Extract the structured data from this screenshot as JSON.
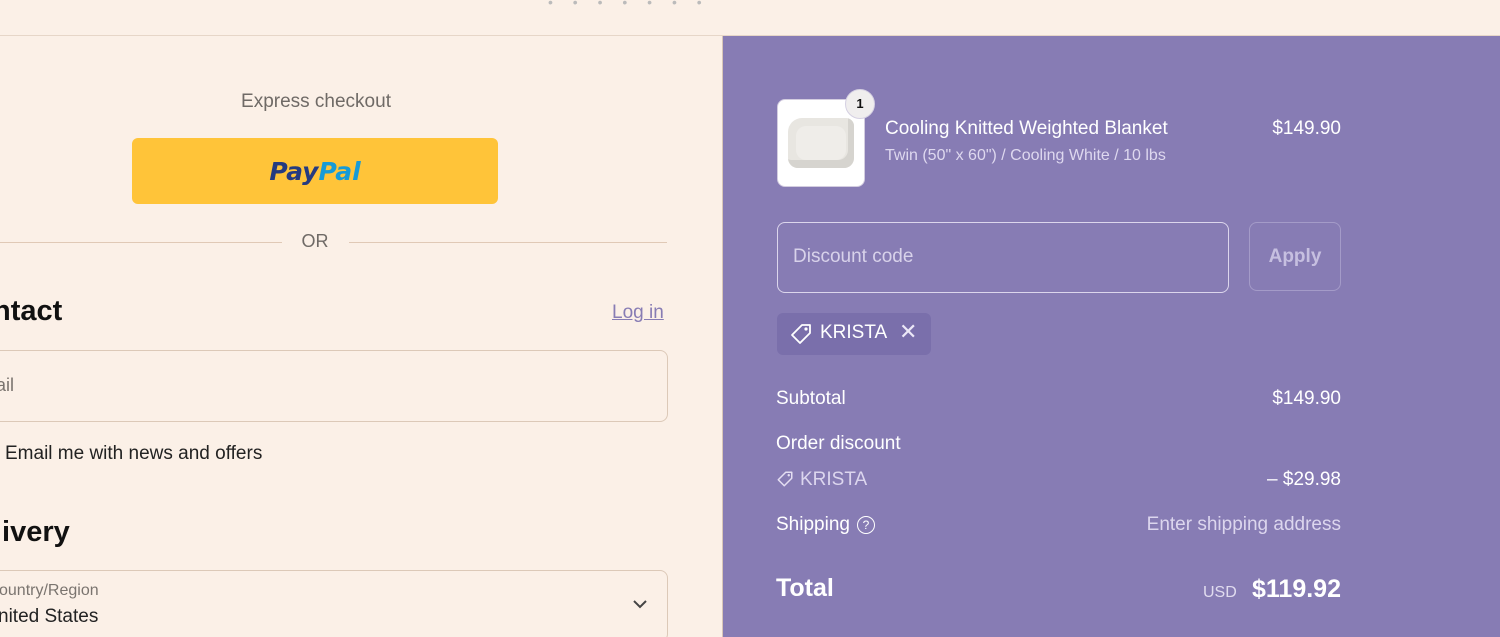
{
  "topbar": {
    "dots": "• • • • • • •"
  },
  "checkout": {
    "express_label": "Express checkout",
    "paypal_part1": "Pay",
    "paypal_part2": "Pal",
    "or_text": "OR",
    "contact_heading": "ntact",
    "login_link": "Log in",
    "email_placeholder": "nail",
    "news_label": "Email me with news and offers",
    "delivery_heading": "livery",
    "country_label": "ountry/Region",
    "country_value": "nited States",
    "country_chevron": "chevron-down-icon"
  },
  "summary": {
    "product": {
      "quantity": "1",
      "name": "Cooling Knitted Weighted Blanket",
      "variant": "Twin (50\" x 60\") / Cooling White / 10 lbs",
      "price": "$149.90"
    },
    "discount_placeholder": "Discount code",
    "apply_label": "Apply",
    "applied_code": "KRISTA",
    "subtotal_label": "Subtotal",
    "subtotal_value": "$149.90",
    "order_discount_label": "Order discount",
    "discount_code": "KRISTA",
    "discount_value": "– $29.98",
    "shipping_label": "Shipping",
    "shipping_value": "Enter shipping address",
    "total_label": "Total",
    "total_currency": "USD",
    "total_value": "$119.92"
  },
  "colors": {
    "page_bg": "#fbf0e7",
    "summary_bg": "#877cb4",
    "paypal_yellow": "#ffc439",
    "paypal_navy": "#253b80",
    "paypal_blue": "#179bd7"
  }
}
